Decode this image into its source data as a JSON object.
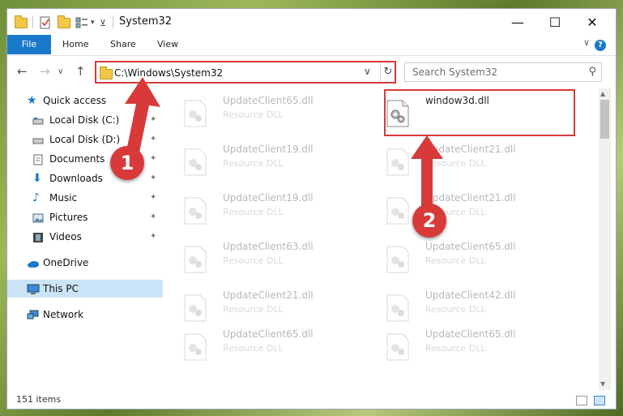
{
  "window": {
    "title": "System32",
    "controls": {
      "minimize": "—",
      "maximize": "☐",
      "close": "✕"
    }
  },
  "ribbon": {
    "tabs": [
      "File",
      "Home",
      "Share",
      "View"
    ],
    "help": "?",
    "collapse": "∨"
  },
  "nav": {
    "back": "←",
    "forward": "→",
    "recent": "∨",
    "up": "↑",
    "address": "C:\\Windows\\System32",
    "address_dropdown": "∨",
    "refresh": "↻",
    "search_placeholder": "Search System32"
  },
  "sidebar": {
    "items": [
      {
        "label": "Quick access",
        "icon": "star-icon",
        "pinned": false
      },
      {
        "label": "Local Disk (C:)",
        "icon": "drive-icon",
        "pinned": true
      },
      {
        "label": "Local Disk (D:)",
        "icon": "drive-icon",
        "pinned": true
      },
      {
        "label": "Documents",
        "icon": "documents-icon",
        "pinned": true
      },
      {
        "label": "Downloads",
        "icon": "downloads-icon",
        "pinned": true
      },
      {
        "label": "Music",
        "icon": "music-icon",
        "pinned": true
      },
      {
        "label": "Pictures",
        "icon": "pictures-icon",
        "pinned": true
      },
      {
        "label": "Videos",
        "icon": "videos-icon",
        "pinned": true
      },
      {
        "label": "OneDrive",
        "icon": "cloud-icon",
        "pinned": false
      },
      {
        "label": "This PC",
        "icon": "computer-icon",
        "pinned": false,
        "selected": true
      },
      {
        "label": "Network",
        "icon": "network-icon",
        "pinned": false
      }
    ],
    "pin_glyph": "📌"
  },
  "files": {
    "left": [
      {
        "name": "UpdateClient65.dll",
        "type": "Resource DLL"
      },
      {
        "name": "UpdateClient19.dll",
        "type": "Resource DLL"
      },
      {
        "name": "UpdateClient19.dll",
        "type": "Resource DLL"
      },
      {
        "name": "UpdateClient63.dll",
        "type": "Resource DLL"
      },
      {
        "name": "UpdateClient21.dll",
        "type": "Resource DLL"
      },
      {
        "name": "UpdateClient65.dll",
        "type": "Resource DLL"
      }
    ],
    "right": [
      {
        "name": "window3d.dll",
        "type": ""
      },
      {
        "name": "UpdateClient21.dll",
        "type": "Resource DLL"
      },
      {
        "name": "UpdateClient21.dll",
        "type": "Resource DLL"
      },
      {
        "name": "UpdateClient65.dll",
        "type": "Resource DLL"
      },
      {
        "name": "UpdateClient42.dll",
        "type": "Resource DLL"
      },
      {
        "name": "UpdateClient65.dll",
        "type": "Resource DLL"
      }
    ]
  },
  "status": {
    "count": "151 items"
  },
  "callouts": [
    "1",
    "2"
  ],
  "colors": {
    "accent": "#1979ca",
    "highlight": "#d83a3a",
    "selection": "#cce4f7"
  }
}
